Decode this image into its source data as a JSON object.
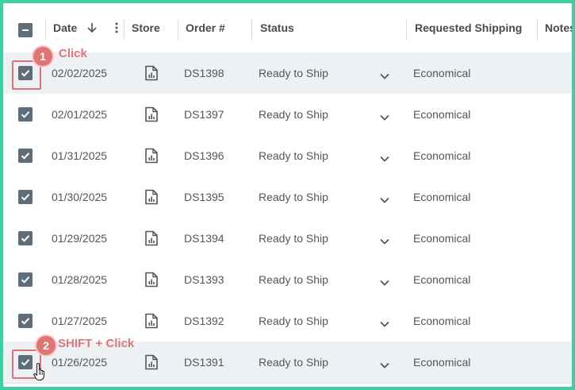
{
  "header": {
    "date": "Date",
    "store": "Store",
    "order": "Order #",
    "status": "Status",
    "shipping": "Requested Shipping",
    "notes": "Notes"
  },
  "rows": [
    {
      "date": "02/02/2025",
      "order": "DS1398",
      "status": "Ready to Ship",
      "shipping": "Economical",
      "checked": true
    },
    {
      "date": "02/01/2025",
      "order": "DS1397",
      "status": "Ready to Ship",
      "shipping": "Economical",
      "checked": true
    },
    {
      "date": "01/31/2025",
      "order": "DS1396",
      "status": "Ready to Ship",
      "shipping": "Economical",
      "checked": true
    },
    {
      "date": "01/30/2025",
      "order": "DS1395",
      "status": "Ready to Ship",
      "shipping": "Economical",
      "checked": true
    },
    {
      "date": "01/29/2025",
      "order": "DS1394",
      "status": "Ready to Ship",
      "shipping": "Economical",
      "checked": true
    },
    {
      "date": "01/28/2025",
      "order": "DS1393",
      "status": "Ready to Ship",
      "shipping": "Economical",
      "checked": true
    },
    {
      "date": "01/27/2025",
      "order": "DS1392",
      "status": "Ready to Ship",
      "shipping": "Economical",
      "checked": true
    },
    {
      "date": "01/26/2025",
      "order": "DS1391",
      "status": "Ready to Ship",
      "shipping": "Economical",
      "checked": true
    }
  ],
  "annotations": {
    "step1_number": "1",
    "step1_text": "Click",
    "step2_number": "2",
    "step2_text": "SHIFT + Click"
  },
  "colors": {
    "frame": "#3ecfa3",
    "checkbox": "#5d6e7a",
    "callout": "#e07575",
    "row_highlight": "#eef1f4"
  },
  "icons": {
    "select_all": "minus-checkbox-icon",
    "sort": "arrow-down-icon",
    "menu": "vertical-dots-icon",
    "store": "document-chart-icon",
    "status_dropdown": "chevron-down-icon",
    "cursor": "hand-pointer-icon"
  }
}
